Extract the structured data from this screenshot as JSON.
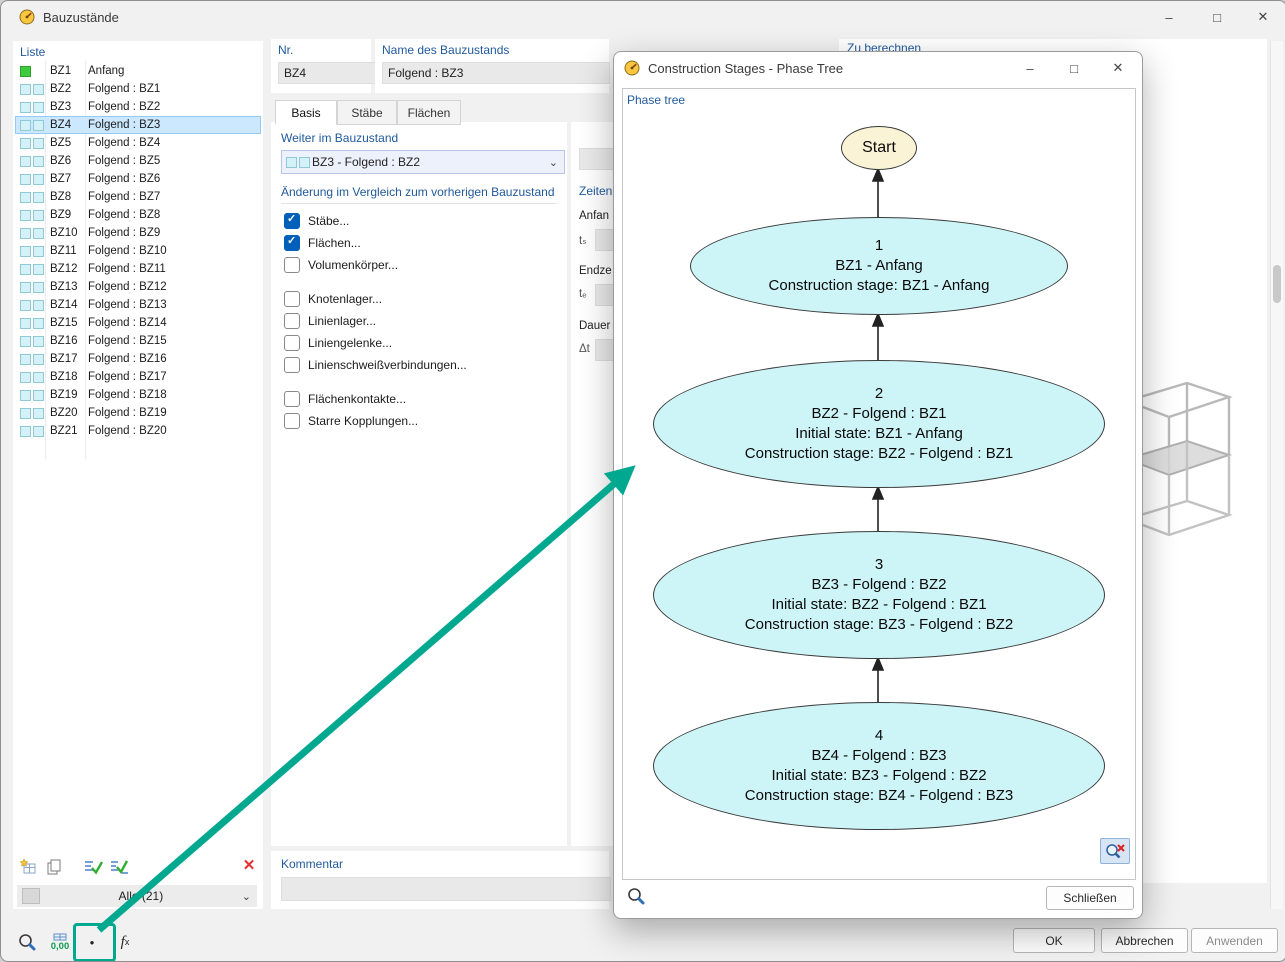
{
  "colors": {
    "label_blue": "#215A9B",
    "selection_blue": "#CCE8FF",
    "checkbox_checked": "#005FB8",
    "stage_node_fill": "#CDF4F7",
    "start_node_fill": "#FBF3D6",
    "annotation_teal": "#00A88F",
    "stage_icon_cyan": "#D3F1F7",
    "bz1_icon_green": "#3DCB3D",
    "red_x": "#E03030"
  },
  "icons": {
    "minimize_glyph": "–",
    "maximize_glyph": "□",
    "close_glyph": "✕",
    "chevron_down": "⌄",
    "red_x": "✕",
    "dot": "●"
  },
  "window": {
    "title": "Bauzustände"
  },
  "liste": {
    "label": "Liste",
    "items": [
      {
        "id": "BZ1",
        "desc": "Anfang",
        "icon_color": "#3DCB3D"
      },
      {
        "id": "BZ2",
        "desc": "Folgend : BZ1"
      },
      {
        "id": "BZ3",
        "desc": "Folgend : BZ2"
      },
      {
        "id": "BZ4",
        "desc": "Folgend : BZ3",
        "selected": true
      },
      {
        "id": "BZ5",
        "desc": "Folgend : BZ4"
      },
      {
        "id": "BZ6",
        "desc": "Folgend : BZ5"
      },
      {
        "id": "BZ7",
        "desc": "Folgend : BZ6"
      },
      {
        "id": "BZ8",
        "desc": "Folgend : BZ7"
      },
      {
        "id": "BZ9",
        "desc": "Folgend : BZ8"
      },
      {
        "id": "BZ10",
        "desc": "Folgend : BZ9"
      },
      {
        "id": "BZ11",
        "desc": "Folgend : BZ10"
      },
      {
        "id": "BZ12",
        "desc": "Folgend : BZ11"
      },
      {
        "id": "BZ13",
        "desc": "Folgend : BZ12"
      },
      {
        "id": "BZ14",
        "desc": "Folgend : BZ13"
      },
      {
        "id": "BZ15",
        "desc": "Folgend : BZ14"
      },
      {
        "id": "BZ16",
        "desc": "Folgend : BZ15"
      },
      {
        "id": "BZ17",
        "desc": "Folgend : BZ16"
      },
      {
        "id": "BZ18",
        "desc": "Folgend : BZ17"
      },
      {
        "id": "BZ19",
        "desc": "Folgend : BZ18"
      },
      {
        "id": "BZ20",
        "desc": "Folgend : BZ19"
      },
      {
        "id": "BZ21",
        "desc": "Folgend : BZ20"
      }
    ],
    "filter_value": "Alle (21)"
  },
  "details": {
    "nr_label": "Nr.",
    "nr_value": "BZ4",
    "name_label": "Name des Bauzustands",
    "name_value": "Folgend : BZ3",
    "tabs": [
      "Basis",
      "Stäbe",
      "Flächen"
    ],
    "active_tab": "Basis",
    "weiter_label": "Weiter im Bauzustand",
    "weiter_value": "BZ3 - Folgend : BZ2",
    "aenderung_label": "Änderung im Vergleich zum vorherigen Bauzustand",
    "checkboxes": [
      {
        "label": "Stäbe...",
        "checked": true
      },
      {
        "label": "Flächen...",
        "checked": true
      },
      {
        "label": "Volumenkörper...",
        "checked": false
      },
      {
        "label": "Knotenlager...",
        "checked": false,
        "gap_before": true
      },
      {
        "label": "Linienlager...",
        "checked": false
      },
      {
        "label": "Liniengelenke...",
        "checked": false
      },
      {
        "label": "Linienschweißverbindungen...",
        "checked": false
      },
      {
        "label": "Flächenkontakte...",
        "checked": false,
        "gap_before": true
      },
      {
        "label": "Starre Kopplungen...",
        "checked": false
      }
    ],
    "kommentar_label": "Kommentar",
    "kommentar_value": ""
  },
  "zeiten": {
    "heading": "Zeiten",
    "anfang_label": "Anfan",
    "ts_label": "tₛ",
    "endzeit_label": "Endze",
    "te_label": "tₑ",
    "dauer_label": "Dauer",
    "dt_label": "Δt"
  },
  "right_panel": {
    "heading": "Zu berechnen"
  },
  "phase_dialog": {
    "title": "Construction Stages - Phase Tree",
    "tree_label": "Phase tree",
    "close_label": "Schließen",
    "nodes": [
      {
        "lines": [
          "Start"
        ]
      },
      {
        "lines": [
          "1",
          "BZ1 - Anfang",
          "Construction stage: BZ1 - Anfang"
        ]
      },
      {
        "lines": [
          "2",
          "BZ2 - Folgend : BZ1",
          "Initial state: BZ1 - Anfang",
          "Construction stage: BZ2 - Folgend : BZ1"
        ]
      },
      {
        "lines": [
          "3",
          "BZ3 - Folgend : BZ2",
          "Initial state: BZ2 - Folgend : BZ1",
          "Construction stage: BZ3 - Folgend : BZ2"
        ]
      },
      {
        "lines": [
          "4",
          "BZ4 - Folgend : BZ3",
          "Initial state: BZ3 - Folgend : BZ2",
          "Construction stage: BZ4 - Folgend : BZ3"
        ]
      }
    ]
  },
  "footer": {
    "ok": "OK",
    "cancel": "Abbrechen",
    "apply": "Anwenden",
    "unit_value": "0,00",
    "fx": "f"
  }
}
